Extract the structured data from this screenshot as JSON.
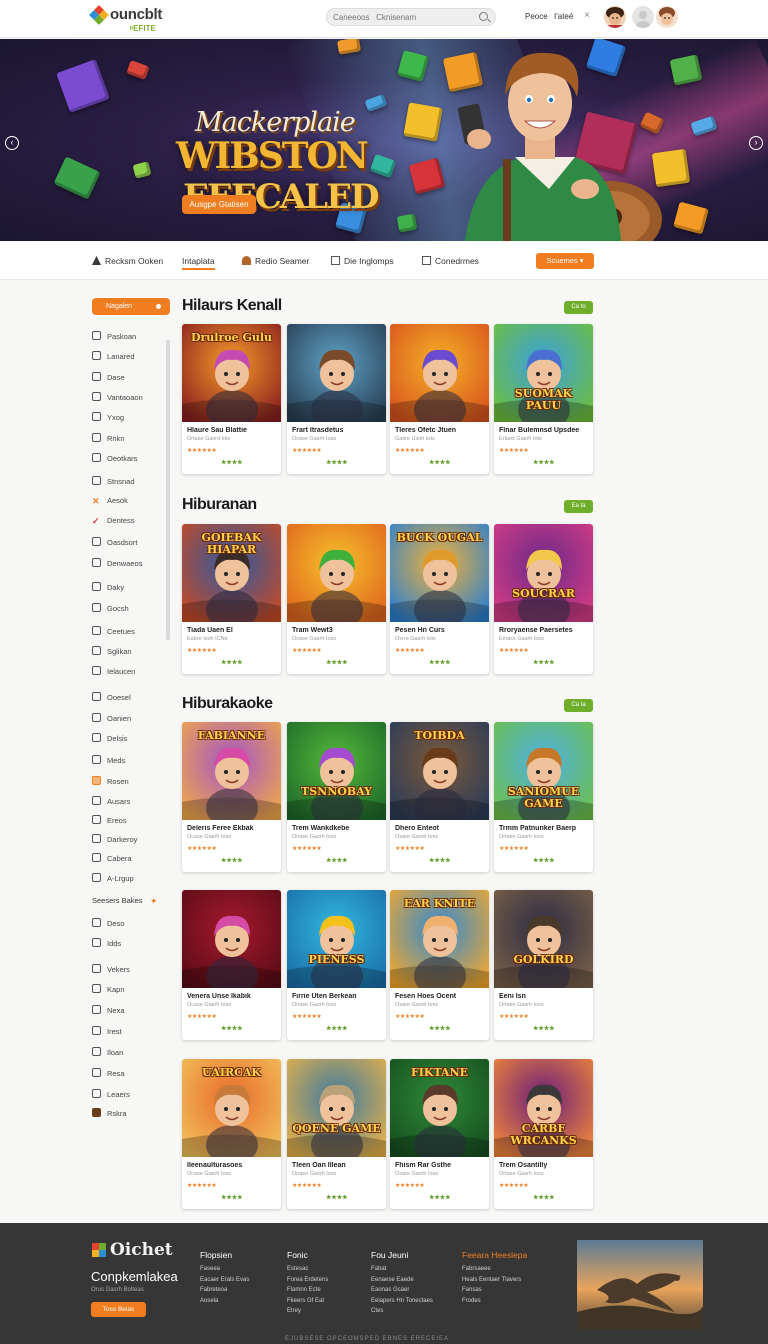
{
  "header": {
    "logo_name": "ouncblt",
    "logo_sub": "ᵖEFITE",
    "search_placeholder": "Caneeoos   Cknisenam",
    "link1": "Peoce",
    "link2": "I'ateé",
    "close": "×"
  },
  "hero": {
    "title1": "Mackerplaie",
    "title2": "WIBSTON",
    "title3": "EEECALED",
    "button": "Ausgpe Gtatisen"
  },
  "tabs": {
    "items": [
      "Recksm Ooken",
      "Intaplata",
      "Redio Seamer",
      "Die Inglomps",
      "Conedrmes"
    ],
    "button": "Scuemes"
  },
  "sidebar": {
    "pill": "Nagalen",
    "items": [
      "Paskoan",
      "Lanared",
      "Dase",
      "Vantaoaon",
      "Yxog",
      "Rnkn",
      "Oeotkars",
      "Stnsnad",
      "Aesok",
      "Dentess",
      "Oasdsort",
      "Denwaeos",
      "Daky",
      "Gocsh",
      "Ceetues",
      "Sglikan",
      "Ielaucen",
      "Ooesel",
      "Oanien",
      "Delsis",
      "Meds",
      "Rosen",
      "Ausars",
      "Ereos",
      "Darkeroy",
      "Cabera",
      "A-Lrgup"
    ],
    "head": "Seesers Bakes",
    "items2": [
      "Deso",
      "Idds",
      "Vekers",
      "Kapn",
      "Nexa",
      "Irest",
      "Iloan",
      "Resa",
      "Leaers",
      "Rskra"
    ]
  },
  "sections": [
    {
      "title": "Hilaurs Kenall",
      "badge": "Ca to"
    },
    {
      "title": "Hiburanan",
      "badge": "Ea ta"
    },
    {
      "title": "Hiburakaoke",
      "badge": "Ca ta"
    }
  ],
  "cards": [
    {
      "title": "Hlaure Sau Blattie",
      "sub": "Ortase Gasrd Iole",
      "stars": "★★★★★★",
      "rate": "★★★★"
    },
    {
      "title": "Frart Itrasdetus",
      "sub": "Ocase Gasrh Ioas",
      "stars": "★★★★★★",
      "rate": "★★★★"
    },
    {
      "title": "Tleres Ofetc Jtuen",
      "sub": "Gasre Usoh Iots",
      "stars": "★★★★★★",
      "rate": "★★★★"
    },
    {
      "title": "Flnar Bulemnsd Upsdee",
      "sub": "Ertaes Gasrh Iots",
      "stars": "★★★★★★",
      "rate": "★★★★"
    },
    {
      "title": "Tiada Uaen El",
      "sub": "Eabre Isoh ICNe",
      "stars": "★★★★★★",
      "rate": "★★★★"
    },
    {
      "title": "Tram Wewt3",
      "sub": "Ocase Gasrh Ioss",
      "stars": "★★★★★★",
      "rate": "★★★★"
    },
    {
      "title": "Pesen Hn Curs",
      "sub": "Osrre Gasrh Iots",
      "stars": "★★★★★★",
      "rate": "★★★★"
    },
    {
      "title": "Rroryaense Paersetes",
      "sub": "Emass Gasrh Ioss",
      "stars": "★★★★★★",
      "rate": "★★★★"
    },
    {
      "title": "Deleris Feree Ekbak",
      "sub": "Ocase Gasrh Ioss",
      "stars": "★★★★★★",
      "rate": "★★★★"
    },
    {
      "title": "Trem Wankdkebe",
      "sub": "Onase Gasrh Ioss",
      "stars": "★★★★★★",
      "rate": "★★★★"
    },
    {
      "title": "Dhero Enteot",
      "sub": "Osare Gasrh Ioss",
      "stars": "★★★★★★",
      "rate": "★★★★"
    },
    {
      "title": "Trmm Patnunker Baerp",
      "sub": "Ortase Gasrh Ioss",
      "stars": "★★★★★★",
      "rate": "★★★★"
    },
    {
      "title": "Venera Unse Ikabik",
      "sub": "Ocase Gasrh Ioss",
      "stars": "★★★★★★",
      "rate": "★★★★"
    },
    {
      "title": "Firrie Uten Berkean",
      "sub": "Onase Gasrh Ioss",
      "stars": "★★★★★★",
      "rate": "★★★★"
    },
    {
      "title": "Fesen Hoes Ocent",
      "sub": "Osare Gasrh Ioss",
      "stars": "★★★★★★",
      "rate": "★★★★"
    },
    {
      "title": "Eeni Isn",
      "sub": "Ortase Gasrh Ioss",
      "stars": "★★★★★★",
      "rate": "★★★★"
    },
    {
      "title": "Ileenaulturasoes",
      "sub": "Ocase Gasrh Ioss",
      "stars": "★★★★★★",
      "rate": "★★★★"
    },
    {
      "title": "Tleen Oan Illean",
      "sub": "Onase Gasrh Ioss",
      "stars": "★★★★★★",
      "rate": "★★★★"
    },
    {
      "title": "Fhism Rar Gsthe",
      "sub": "Osare Gasrh Ioss",
      "stars": "★★★★★★",
      "rate": "★★★★"
    },
    {
      "title": "Trem Osantilly",
      "sub": "Ortase Gasrh Ioss",
      "stars": "★★★★★★",
      "rate": "★★★★"
    }
  ],
  "art_text": [
    "Drulroe Gulu",
    "",
    "",
    "SUOMAK PAUU",
    "GOIEBAK HIAPAR",
    "",
    "BUCK OUGAL",
    "SOUCRAR",
    "FABIANNE",
    "TSNNOBAY",
    "TOIBDA",
    "SANIOMUE GAME",
    "",
    "PIENESS",
    "EAR KNITE",
    "GOLKIRD",
    "UAIRCAK",
    "QOENE GAME",
    "FIKTANE",
    "CARBF WRCANKS"
  ],
  "footer": {
    "logo": "Oichet",
    "name": "Conpkemlakea",
    "sub": "Orus Gasrh Bolteas",
    "button": "Toss Beias",
    "cols": [
      {
        "title": "Flopsien",
        "links": [
          "Faseea",
          "Eacaer Erals Evas",
          "Fabreteoa",
          "Aosela"
        ]
      },
      {
        "title": "Fonic",
        "links": [
          "Estesac",
          "Forea Erdetens",
          "Flamnn Ecte",
          "Fkeers Gf Eat",
          "Etrey"
        ]
      },
      {
        "title": "Fou Jeuni",
        "links": [
          "Fabat",
          "Eenaese Eaede",
          "Eaonas Gcaer",
          "Eelapers Hn Tonectaes",
          "Ctes"
        ]
      },
      {
        "title": "Feeara Heeslepa",
        "links": [
          "Fabrsaeee",
          "Heals Eentaer Tlavers",
          "Fansas",
          "Frodes"
        ]
      }
    ],
    "copyright": "EJUBSESE OPCEOMSPED EBNES ERECEIEA"
  },
  "colors": {
    "accent": "#f07e21",
    "green": "#6fae2b",
    "footer_bg": "#363636"
  }
}
